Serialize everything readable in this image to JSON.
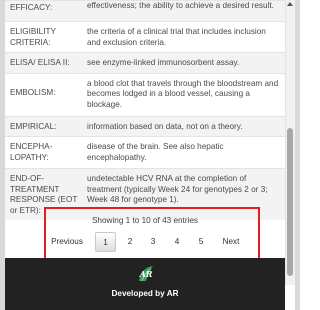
{
  "glossary": {
    "rows": [
      {
        "term": "EFFICACY:",
        "definition": "effectiveness; the ability to achieve a desired result."
      },
      {
        "term": "ELIGIBILITY CRITERIA:",
        "definition": "the criteria of a clinical trial that includes inclusion and exclusion criteria."
      },
      {
        "term": "ELISA/ ELISA II:",
        "definition": "see enzyme-linked immunosorbent assay."
      },
      {
        "term": "EMBOLISM:",
        "definition": "a blood clot that travels through the bloodstream and becomes lodged in a blood vessel, causing a blockage."
      },
      {
        "term": "EMPIRICAL:",
        "definition": "information based on data, not on a theory."
      },
      {
        "term": "ENCEPHA-LOPATHY:",
        "definition": "disease of the brain. See also hepatic encephalopathy."
      },
      {
        "term": "END-OF-TREATMENT RESPONSE (EOT or ETR):",
        "definition": "undetectable HCV RNA at the completion of treatment (typically Week 24 for genotypes 2 or 3; Week 48 for genotype 1)."
      }
    ]
  },
  "pagination": {
    "info": "Showing 1 to 10 of 43 entries",
    "previous": "Previous",
    "pages": [
      "1",
      "2",
      "3",
      "4",
      "5"
    ],
    "current_page": "1",
    "next": "Next"
  },
  "footer": {
    "logo_text": "AR",
    "credit": "Developed by AR"
  },
  "colors": {
    "highlight": "#e02020",
    "footer_bg": "#222222",
    "logo_green": "#3cb371"
  }
}
